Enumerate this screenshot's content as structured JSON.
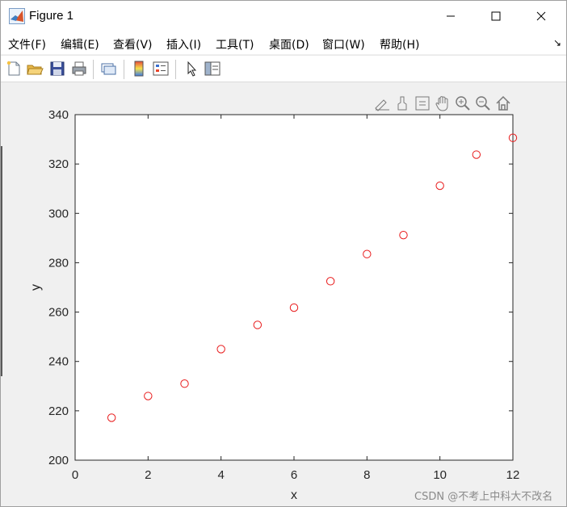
{
  "window": {
    "title": "Figure 1"
  },
  "menu": {
    "items": [
      {
        "label": "文件(F)"
      },
      {
        "label": "编辑(E)"
      },
      {
        "label": "查看(V)"
      },
      {
        "label": "插入(I)"
      },
      {
        "label": "工具(T)"
      },
      {
        "label": "桌面(D)"
      },
      {
        "label": "窗口(W)"
      },
      {
        "label": "帮助(H)"
      }
    ],
    "dock_glyph": "↘"
  },
  "toolbar": {
    "icons": [
      "new-figure-icon",
      "open-file-icon",
      "save-icon",
      "print-icon",
      "link-plot-icon",
      "colorbar-icon",
      "legend-icon",
      "pointer-icon",
      "property-inspector-icon"
    ]
  },
  "axes_toolbar": {
    "icons": [
      "brush-edit-icon",
      "data-brush-icon",
      "data-tips-icon",
      "pan-hand-icon",
      "zoom-in-icon",
      "zoom-out-icon",
      "home-restore-icon"
    ]
  },
  "chart_data": {
    "type": "scatter",
    "x": [
      1,
      2,
      3,
      4,
      5,
      6,
      7,
      8,
      9,
      10,
      11,
      12
    ],
    "y": [
      217.2,
      226.0,
      231.0,
      245.0,
      254.8,
      261.8,
      272.5,
      283.5,
      291.2,
      311.2,
      323.8,
      330.6
    ],
    "xlabel": "x",
    "ylabel": "y",
    "xlim": [
      0,
      12
    ],
    "ylim": [
      200,
      340
    ],
    "xticks": [
      "0",
      "2",
      "4",
      "6",
      "8",
      "10",
      "12"
    ],
    "yticks": [
      "200",
      "220",
      "240",
      "260",
      "280",
      "300",
      "320",
      "340"
    ],
    "marker": "circle",
    "marker_color": "#e8191a",
    "grid": false
  },
  "watermark": "CSDN @不考上中科大不改名"
}
